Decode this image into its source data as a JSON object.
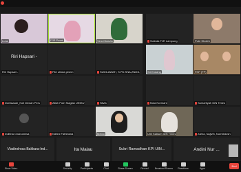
{
  "window": {
    "recording_label": "Recording"
  },
  "tiles": [
    {
      "name": "Luna",
      "big": ""
    },
    {
      "name": "FJR Pusat",
      "big": ""
    },
    {
      "name": "Vina Oktavia",
      "big": ""
    },
    {
      "name": "Sulinda FJR Lampung",
      "big": ""
    },
    {
      "name": "Putri Sholeh",
      "big": ""
    },
    {
      "name": "Riri Hapsari -",
      "big": "Riri Hapsari -"
    },
    {
      "name": "Fitri ulinda pinem",
      "big": ""
    },
    {
      "name": "SUDILAWATI, S.PD.SNA,ZNIZA",
      "big": ""
    },
    {
      "name": "Sri Endang",
      "big": ""
    },
    {
      "name": "FKP (FP)",
      "big": ""
    },
    {
      "name": "Dorlasaudi_Koll Dewan Pers",
      "big": ""
    },
    {
      "name": "Alfah Putri Siagian UINSU",
      "big": ""
    },
    {
      "name": "Silvia",
      "big": ""
    },
    {
      "name": "Nola Normani",
      "big": ""
    },
    {
      "name": "Sumartiyah IDN Times",
      "big": ""
    },
    {
      "name": "Indifina Chairunnisa",
      "big": ""
    },
    {
      "name": "Ndhini Fathiriana",
      "big": ""
    },
    {
      "name": "Meido",
      "big": ""
    },
    {
      "name": "Umi Kalsum IDN Times",
      "big": ""
    },
    {
      "name": "Zahra, Najwih, Nurmbdosh",
      "big": ""
    },
    {
      "name": "Vladirolrosa Bakkara-Indonesia",
      "big": "Vladirolrosa Bakkara-Ind..."
    },
    {
      "name": "Ita Malau",
      "big": "Ita Malau"
    },
    {
      "name": "Sukri Ramadhan KPI UIN...",
      "big": "Sukri Ramadhan KPI UIN..."
    },
    {
      "name": "Andini Nur ...",
      "big": "Andini Nur ..."
    }
  ],
  "toolbar": {
    "show_video": "Show Video",
    "participants": "Participants",
    "chat": "Chat",
    "share_screen": "Share Screen",
    "record": "Record",
    "breakout_rooms": "Breakout Rooms",
    "reactions": "Reactions",
    "apps": "Apps",
    "security": "Security",
    "end": "End"
  }
}
